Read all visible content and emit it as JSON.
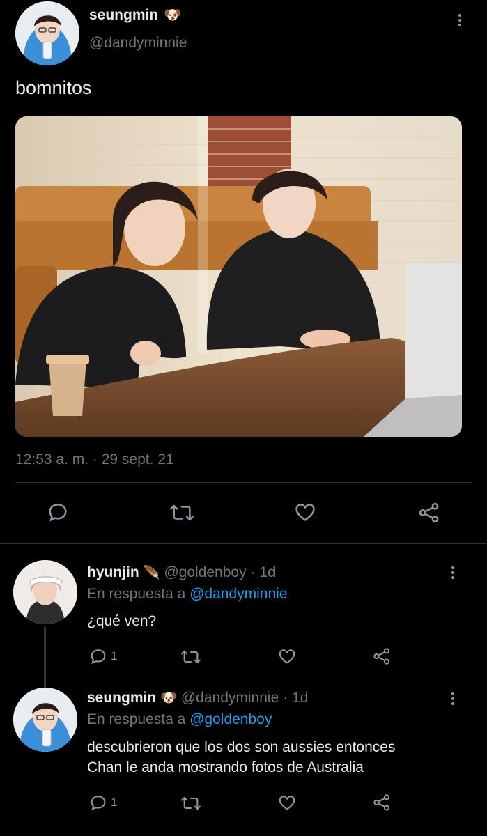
{
  "main_tweet": {
    "author_name": "seungmin",
    "author_emoji": "🐶",
    "handle": "@dandyminnie",
    "text": "bomnitos",
    "timestamp": "12:53 a. m. · 29 sept. 21"
  },
  "replies": [
    {
      "author_name": "hyunjin",
      "author_emoji": "🪶",
      "handle": "@goldenboy",
      "age": "· 1d",
      "reply_prefix": "En respuesta a",
      "reply_to": "@dandyminnie",
      "text": "¿qué ven?",
      "reply_count": "1"
    },
    {
      "author_name": "seungmin",
      "author_emoji": "🐶",
      "handle": "@dandyminnie",
      "age": "· 1d",
      "reply_prefix": "En respuesta a",
      "reply_to": "@goldenboy",
      "text_line1": "descubrieron que los dos son aussies entonces",
      "text_line2": "Chan le anda mostrando fotos de Australia",
      "reply_count": "1"
    }
  ],
  "icons": {
    "reply": "reply-icon",
    "retweet": "retweet-icon",
    "like": "heart-icon",
    "share": "share-icon",
    "more": "more-icon"
  },
  "colors": {
    "background": "#000000",
    "link": "#1d9bf0",
    "muted": "#71767b",
    "divider": "#2f3336"
  }
}
